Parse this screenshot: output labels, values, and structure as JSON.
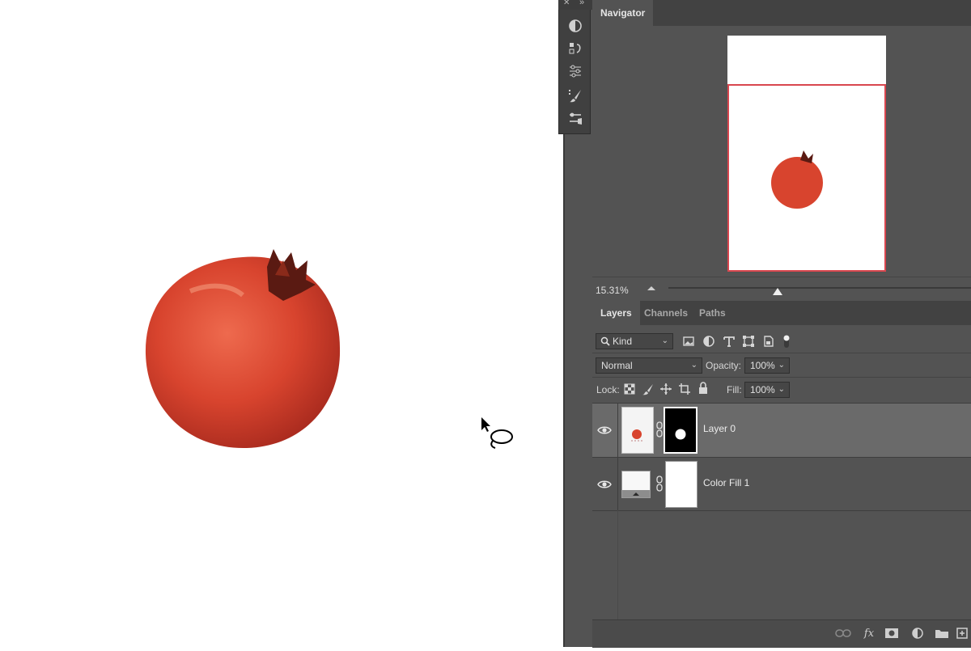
{
  "navigator": {
    "tab_label": "Navigator",
    "zoom_level": "15.31%",
    "zoom_slider_fraction": 0.36
  },
  "layers_panel": {
    "tabs": [
      {
        "label": "Layers",
        "active": true
      },
      {
        "label": "Channels",
        "active": false
      },
      {
        "label": "Paths",
        "active": false
      }
    ],
    "filter_kind": "Kind",
    "blend_mode": "Normal",
    "opacity_label": "Opacity:",
    "opacity_value": "100%",
    "lock_label": "Lock:",
    "fill_label": "Fill:",
    "fill_value": "100%",
    "layers": [
      {
        "name": "Layer 0",
        "selected": true
      },
      {
        "name": "Color Fill 1",
        "selected": false
      }
    ]
  },
  "bottom_bar": {
    "fx_label": "fx"
  },
  "colors": {
    "panel_bg": "#535353",
    "tab_bar_bg": "#424242",
    "selected_layer_bg": "#6a6a6a",
    "navigator_frame": "#d9474f",
    "pomegranate": "#d8442e"
  }
}
